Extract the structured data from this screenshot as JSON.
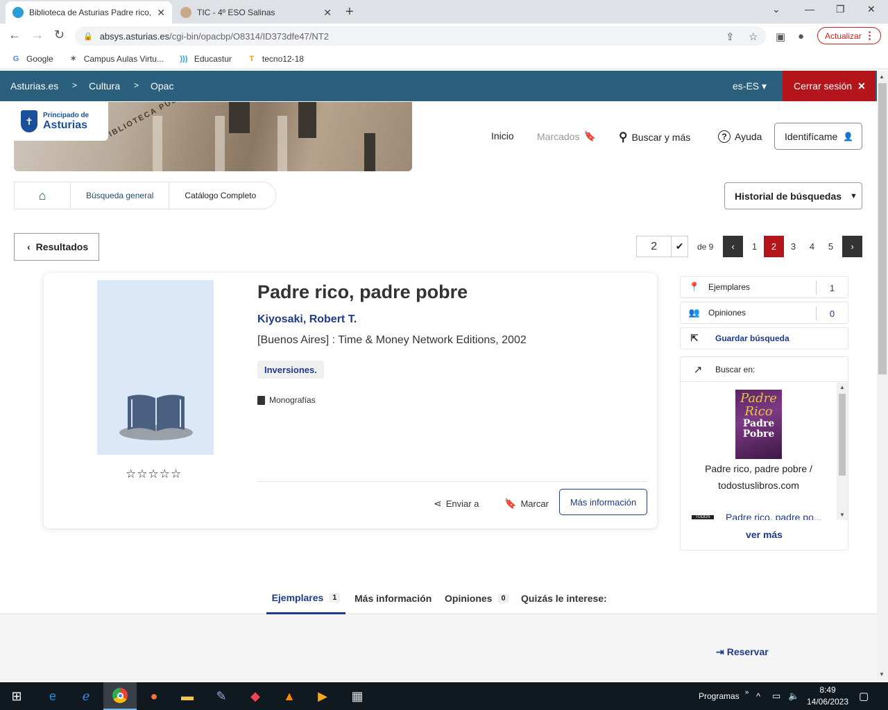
{
  "browser": {
    "tabs": [
      {
        "title": "Biblioteca de Asturias Padre rico,"
      },
      {
        "title": "TIC - 4º ESO Salinas"
      }
    ],
    "url_host": "absys.asturias.es",
    "url_path": "/cgi-bin/opacbp/O8314/ID373dfe47/NT2",
    "update_label": "Actualizar",
    "bookmarks": [
      {
        "label": "Google"
      },
      {
        "label": "Campus Aulas Virtu..."
      },
      {
        "label": "Educastur"
      },
      {
        "label": "tecno12-18"
      }
    ]
  },
  "topnav": {
    "crumbs": [
      "Asturias.es",
      "Cultura",
      "Opac"
    ],
    "sep": ">",
    "lang": "es-ES",
    "logout": "Cerrar sesión"
  },
  "logo": {
    "line1": "Principado de",
    "line2": "Asturias"
  },
  "banner_sign": "BIBLIOTECA PÚBLICA",
  "menu": {
    "inicio": "Inicio",
    "marcados": "Marcados",
    "buscar": "Buscar y más",
    "ayuda": "Ayuda",
    "identificame": "Identifícame"
  },
  "breadcrumb": {
    "items": [
      "Búsqueda general",
      "Catálogo Completo"
    ]
  },
  "historial": "Historial de búsquedas",
  "resultados": "Resultados",
  "pager": {
    "current_input": "2",
    "of_label": "de 9",
    "pages": [
      "1",
      "2",
      "3",
      "4",
      "5"
    ],
    "current": "2"
  },
  "record": {
    "title": "Padre rico, padre pobre",
    "author": "Kiyosaki, Robert T.",
    "publication": "[Buenos Aires] : Time & Money Network Editions, 2002",
    "subject": "Inversiones.",
    "format": "Monografías",
    "rating": 0,
    "stars": "☆☆☆☆☆"
  },
  "actions": {
    "enviar": "Enviar a",
    "marcar": "Marcar",
    "mas_info": "Más información"
  },
  "sidebar": {
    "ejemplares": {
      "label": "Ejemplares",
      "count": "1"
    },
    "opiniones": {
      "label": "Opiniones",
      "count": "0"
    },
    "guardar": "Guardar búsqueda",
    "buscar_en": "Buscar en:",
    "result_caption_1": "Padre rico, padre pobre /",
    "result_caption_2": "todostuslibros.com",
    "next_result": "Padre rico, padre po...",
    "mini_logo": "TODOS",
    "cover_l1": "Padre",
    "cover_l2": "Rico",
    "cover_l3": "Padre Pobre",
    "ver_mas": "ver más"
  },
  "tabs": [
    {
      "label": "Ejemplares",
      "badge": "1"
    },
    {
      "label": "Más información"
    },
    {
      "label": "Opiniones",
      "badge": "0"
    },
    {
      "label": "Quizás le interese:"
    }
  ],
  "reservar": "Reservar",
  "taskbar": {
    "programas": "Programas",
    "time": "8:49",
    "date": "14/06/2023"
  }
}
